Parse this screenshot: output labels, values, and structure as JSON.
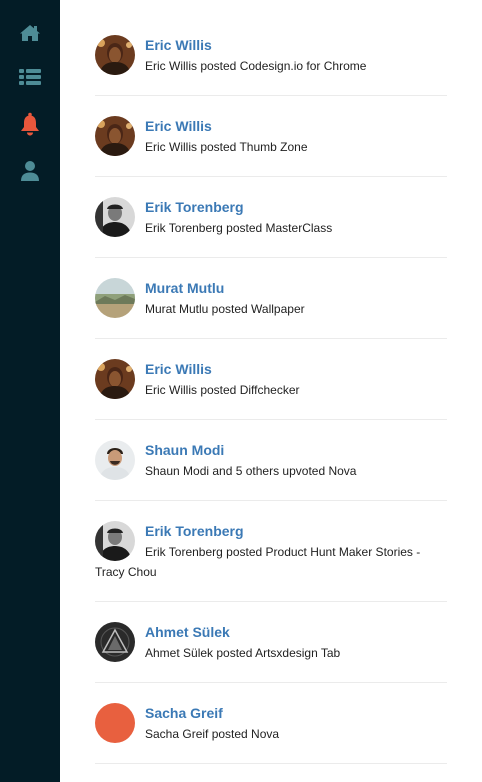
{
  "sidebar": {
    "items": [
      {
        "icon": "home-icon",
        "color": "#4e8c96"
      },
      {
        "icon": "list-icon",
        "color": "#4e8c96"
      },
      {
        "icon": "bell-icon",
        "color": "#e8573c",
        "active": true
      },
      {
        "icon": "user-icon",
        "color": "#4e8c96"
      }
    ]
  },
  "feed": {
    "items": [
      {
        "name": "Eric Willis",
        "text": "Eric Willis posted Codesign.io for Chrome",
        "avatar": "avatar-eric"
      },
      {
        "name": "Eric Willis",
        "text": "Eric Willis posted Thumb Zone",
        "avatar": "avatar-eric"
      },
      {
        "name": "Erik Torenberg",
        "text": "Erik Torenberg posted MasterClass",
        "avatar": "avatar-erik"
      },
      {
        "name": "Murat Mutlu",
        "text": "Murat Mutlu posted Wallpaper",
        "avatar": "avatar-murat"
      },
      {
        "name": "Eric Willis",
        "text": "Eric Willis posted Diffchecker",
        "avatar": "avatar-eric"
      },
      {
        "name": "Shaun Modi",
        "text": "Shaun Modi and 5 others upvoted Nova",
        "avatar": "avatar-shaun"
      },
      {
        "name": "Erik Torenberg",
        "text": "Erik Torenberg posted Product Hunt Maker Stories - Tracy Chou",
        "avatar": "avatar-erik"
      },
      {
        "name": "Ahmet Sülek",
        "text": "Ahmet Sülek posted Artsxdesign Tab",
        "avatar": "avatar-ahmet"
      },
      {
        "name": "Sacha Greif",
        "text": "Sacha Greif posted Nova",
        "avatar": "avatar-sacha",
        "color": "#e8603f"
      }
    ]
  }
}
